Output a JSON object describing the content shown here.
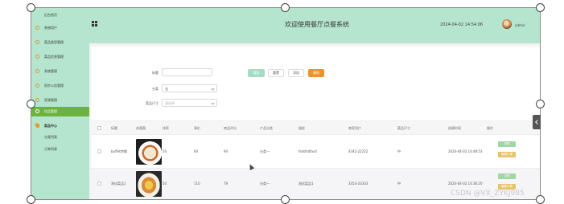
{
  "header": {
    "title": "欢迎使用餐厅点餐系统",
    "timestamp": "2024-04-02 14:54:06",
    "username": "admin"
  },
  "sidebar": {
    "home": "后台首页",
    "items": [
      {
        "label": "系统用户",
        "icon": "circle-icon"
      },
      {
        "label": "菜品类型管理",
        "icon": "circle-icon"
      },
      {
        "label": "菜品信息管理",
        "icon": "circle-icon"
      },
      {
        "label": "系统管理",
        "icon": "circle-icon"
      },
      {
        "label": "同步公告管理",
        "icon": "circle-icon"
      },
      {
        "label": "资源管理",
        "icon": "circle-icon"
      },
      {
        "label": "饮品管理",
        "icon": "circle-icon",
        "active": true
      }
    ],
    "section": "菜品中心",
    "sub_items": [
      "分类列表",
      "订单列表"
    ]
  },
  "filters": {
    "name_label": "标题",
    "name_value": "",
    "category_label": "分类",
    "category_value": "无",
    "size_label": "菜品尺寸",
    "size_placeholder": "请选择"
  },
  "buttons": {
    "search": "搜索",
    "reset": "重置",
    "add": "添加",
    "delete": "删除"
  },
  "table": {
    "columns": [
      "标题",
      "封面图",
      "排序",
      "原价",
      "商品评分",
      "产品分类",
      "描述",
      "商家用户",
      "菜品尺寸",
      "创建时间",
      "操作"
    ],
    "rows": [
      {
        "title": "buffet特辑",
        "image": "food-plate-icon",
        "sort": "50",
        "price": "60",
        "rating": "94",
        "category": "分类一",
        "description": "fsdsfsdfasd",
        "merchant": "4342-22222",
        "size": "中",
        "created": "2024-04-02 14:48:53",
        "ops": [
          "详情",
          "编辑订单"
        ]
      },
      {
        "title": "测试菜品1",
        "image": "food-plate-icon",
        "sort": "50",
        "price": "110",
        "rating": "79",
        "category": "分类一",
        "description": "测试菜品1",
        "merchant": "3353-33333",
        "size": "中",
        "created": "2024-04-02 14:36:20",
        "ops": [
          "详情",
          "编辑订单"
        ]
      }
    ]
  },
  "watermark": "CSDN @VX_ZYKJ985"
}
